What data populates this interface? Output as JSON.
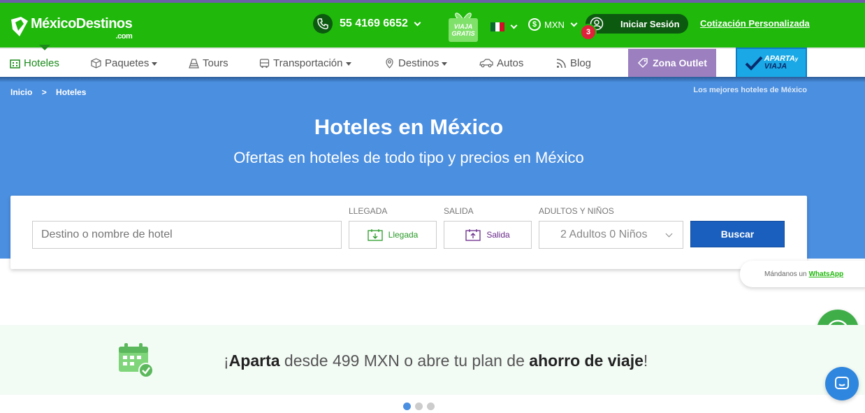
{
  "header": {
    "logo_text": "MéxicoDestinos",
    "logo_suffix": ".com",
    "phone": "55 4169 6652",
    "gift_line1": "VIAJA",
    "gift_line2": "GRATIS",
    "currency": "MXN",
    "notification_count": "3",
    "login_label": "Iniciar Sesión",
    "quote_link": "Cotización Personalizada"
  },
  "nav": {
    "items": [
      {
        "label": "Hoteles",
        "icon": "hotel-icon"
      },
      {
        "label": "Paquetes",
        "icon": "package-icon"
      },
      {
        "label": "Tours",
        "icon": "pyramid-icon"
      },
      {
        "label": "Transportación",
        "icon": "bus-icon"
      },
      {
        "label": "Destinos",
        "icon": "location-icon"
      },
      {
        "label": "Autos",
        "icon": "car-icon"
      },
      {
        "label": "Blog",
        "icon": "rss-icon"
      }
    ],
    "outlet_label": "Zona Outlet",
    "aparta_line1": "APARTA",
    "aparta_small": "y",
    "aparta_line2": "VIAJA"
  },
  "breadcrumb": {
    "home": "Inicio",
    "separator": ">",
    "current": "Hoteles"
  },
  "hero": {
    "tagline": "Los mejores hoteles de México",
    "title": "Hoteles en México",
    "subtitle": "Ofertas en hoteles de todo tipo y precios en México"
  },
  "search": {
    "destination_placeholder": "Destino o nombre de hotel",
    "checkin_label": "LLEGADA",
    "checkin_value": "Llegada",
    "checkout_label": "SALIDA",
    "checkout_value": "Salida",
    "guests_label": "ADULTOS Y NIÑOS",
    "guests_value": "2 Adultos 0 Niños",
    "button": "Buscar"
  },
  "whatsapp": {
    "prompt": "Mándanos un",
    "link": "WhatsApp"
  },
  "promo": {
    "part1": "¡",
    "bold1": "Aparta",
    "part2": " desde 499 MXN o abre tu plan de ",
    "bold2": "ahorro de viaje",
    "part3": "!"
  },
  "colors": {
    "brand_green": "#1fb80b",
    "hero_blue": "#4b8fe0",
    "button_blue": "#1a5fbe",
    "outlet_purple": "#9b7fbf"
  },
  "carousel": {
    "total": 3,
    "active": 1
  }
}
